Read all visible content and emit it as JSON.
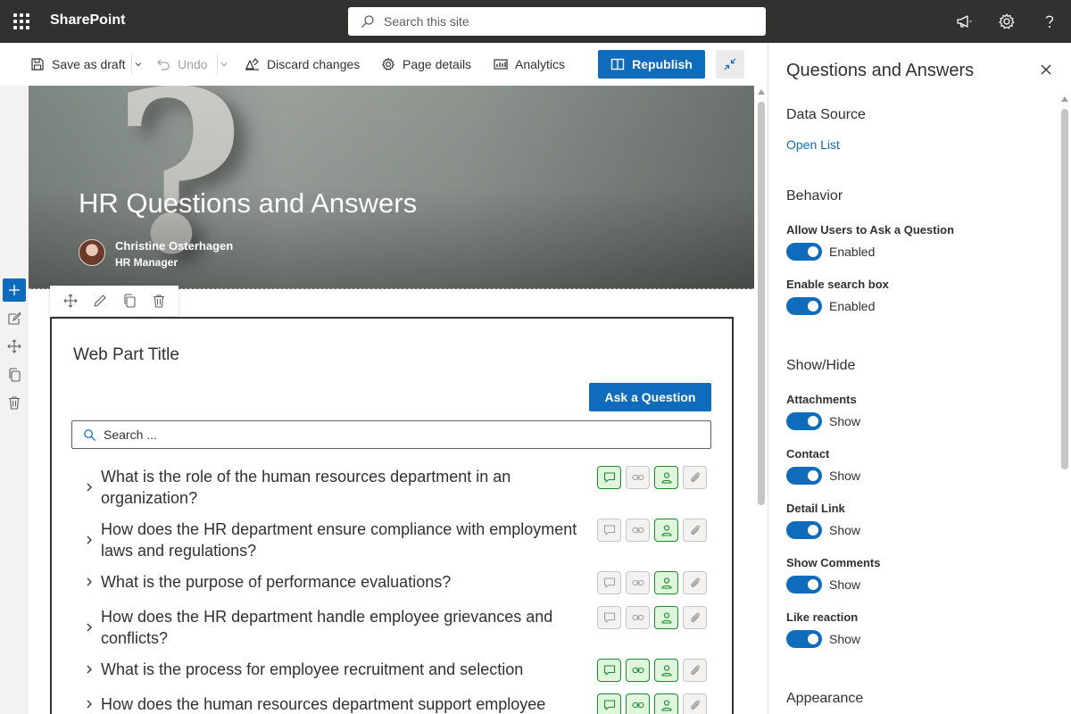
{
  "app": {
    "brand": "SharePoint"
  },
  "search": {
    "placeholder": "Search this site"
  },
  "cmdbar": {
    "save_as_draft": "Save as draft",
    "undo": "Undo",
    "discard_changes": "Discard changes",
    "page_details": "Page details",
    "analytics": "Analytics",
    "republish": "Republish"
  },
  "hero": {
    "title": "HR Questions and Answers",
    "author_name": "Christine Osterhagen",
    "author_role": "HR Manager"
  },
  "webpart": {
    "title": "Web Part Title",
    "ask_button": "Ask a Question",
    "search_placeholder": "Search ...",
    "items": [
      {
        "question": "What is the role of the human resources department in an organization?",
        "icons": [
          "comment-icon",
          "link-icon",
          "contact-icon",
          "attachment-icon"
        ],
        "active": [
          true,
          false,
          true,
          false
        ]
      },
      {
        "question": "How does the HR department ensure compliance with employment laws and regulations?",
        "icons": [
          "comment-icon",
          "link-icon",
          "contact-icon",
          "attachment-icon"
        ],
        "active": [
          false,
          false,
          true,
          false
        ]
      },
      {
        "question": "What is the purpose of performance evaluations?",
        "icons": [
          "comment-icon",
          "link-icon",
          "contact-icon",
          "attachment-icon"
        ],
        "active": [
          false,
          false,
          true,
          false
        ]
      },
      {
        "question": "How does the HR department handle employee grievances and conflicts?",
        "icons": [
          "comment-icon",
          "link-icon",
          "contact-icon",
          "attachment-icon"
        ],
        "active": [
          false,
          false,
          true,
          false
        ]
      },
      {
        "question": "What is the process for employee recruitment and selection",
        "icons": [
          "comment-icon",
          "link-icon",
          "contact-icon",
          "attachment-icon"
        ],
        "active": [
          true,
          true,
          true,
          false
        ]
      },
      {
        "question": "How does the human resources department support employee",
        "icons": [
          "comment-icon",
          "link-icon",
          "contact-icon",
          "attachment-icon"
        ],
        "active": [
          true,
          true,
          true,
          false
        ]
      }
    ]
  },
  "panel": {
    "title": "Questions and Answers",
    "data_source": {
      "heading": "Data Source",
      "link": "Open List"
    },
    "behavior": {
      "heading": "Behavior",
      "settings": [
        {
          "label": "Allow Users to Ask a Question",
          "state": "Enabled"
        },
        {
          "label": "Enable search box",
          "state": "Enabled"
        }
      ]
    },
    "show_hide": {
      "heading": "Show/Hide",
      "settings": [
        {
          "label": "Attachments",
          "state": "Show"
        },
        {
          "label": "Contact",
          "state": "Show"
        },
        {
          "label": "Detail Link",
          "state": "Show"
        },
        {
          "label": "Show Comments",
          "state": "Show"
        },
        {
          "label": "Like reaction",
          "state": "Show"
        }
      ]
    },
    "appearance": {
      "heading": "Appearance"
    }
  },
  "colors": {
    "accent": "#0f6cbd",
    "suite_bar": "#323130",
    "active_icon_border": "#1b8c2b",
    "active_icon_bg": "#dff6dd"
  }
}
